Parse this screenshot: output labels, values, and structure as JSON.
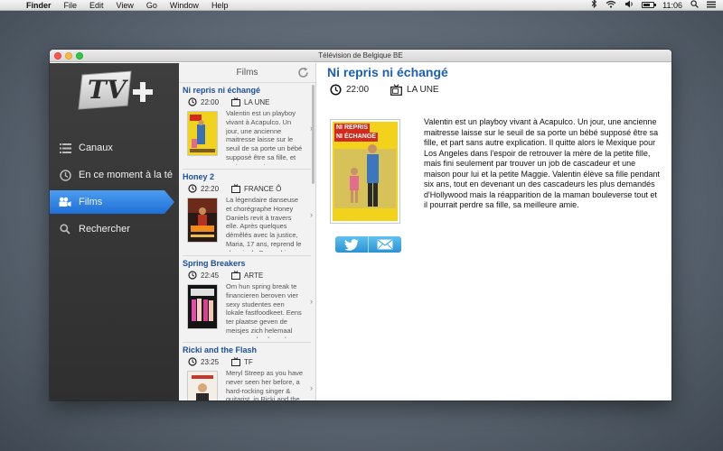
{
  "menubar": {
    "app": "Finder",
    "items": [
      "File",
      "Edit",
      "View",
      "Go",
      "Window",
      "Help"
    ],
    "clock": "11:06",
    "battery_level": 0.65
  },
  "window": {
    "title": "Télévision de Belgique BE"
  },
  "sidebar": {
    "logo_text": "TV",
    "logo_plus": "+",
    "items": [
      {
        "label": "Canaux",
        "icon": "list-icon"
      },
      {
        "label": "En ce moment à la té",
        "icon": "clock-icon"
      },
      {
        "label": "Films",
        "icon": "film-camera-icon",
        "active": true
      },
      {
        "label": "Rechercher",
        "icon": "search-icon"
      }
    ]
  },
  "list": {
    "header": "Films",
    "films": [
      {
        "title": "Ni repris ni échangé",
        "time": "22:00",
        "channel": "LA UNE",
        "description": "Valentin est un playboy vivant à Acapulco. Un jour, une ancienne maitresse laisse sur le seuil de sa porte un bébé supposé être sa fille, et part sans autre explication. Il quitte..."
      },
      {
        "title": "Honey 2",
        "time": "22:20",
        "channel": "FRANCE Ô",
        "description": "La légendaire danseuse et chorégraphe Honey Daniels revit à travers elle. Après quelques démêlés avec la justice, Maria, 17 ans, reprend le chemin du Bronx, bien décidée à rec..."
      },
      {
        "title": "Spring Breakers",
        "time": "22:45",
        "channel": "ARTE",
        "description": "Om hun spring break te financieren beroven vier sexy studentes een lokale fastfoodkeet. Eens ter plaatse geven de meisjes zich helemaal over aan drank en drugs. Ze worde..."
      },
      {
        "title": "Ricki and the Flash",
        "time": "23:25",
        "channel": "TF",
        "description": "Meryl Streep as you have never seen her before, a hard-rocking singer & guitarist, in Ricki and the Flash..."
      }
    ]
  },
  "detail": {
    "title": "Ni repris ni échangé",
    "time": "22:00",
    "channel": "LA UNE",
    "poster_title_1": "NI REPRIS",
    "poster_title_2": "NI ÉCHANGÉ",
    "description": "Valentin est un playboy vivant à Acapulco. Un jour, une ancienne maitresse laisse sur le seuil de sa porte un bébé supposé être sa fille, et part sans autre explication. Il quitte alors le Mexique pour Los Angeles dans l'espoir de retrouver la mère de la petite fille, mais fini seulement par trouver un job de cascadeur et une maison pour lui et la petite Maggie. Valentin élève sa fille pendant six ans, tout en devenant un des cascadeurs les plus demandés d'Hollywood mais la réapparition de la maman bouleverse tout et il pourrait perdre sa fille, sa meilleure amie.",
    "share": [
      "twitter-icon",
      "mail-icon"
    ]
  },
  "colors": {
    "accent": "#1c5fb3",
    "nav_active": "#2f83e4",
    "sidebar_bg": "#353535"
  }
}
